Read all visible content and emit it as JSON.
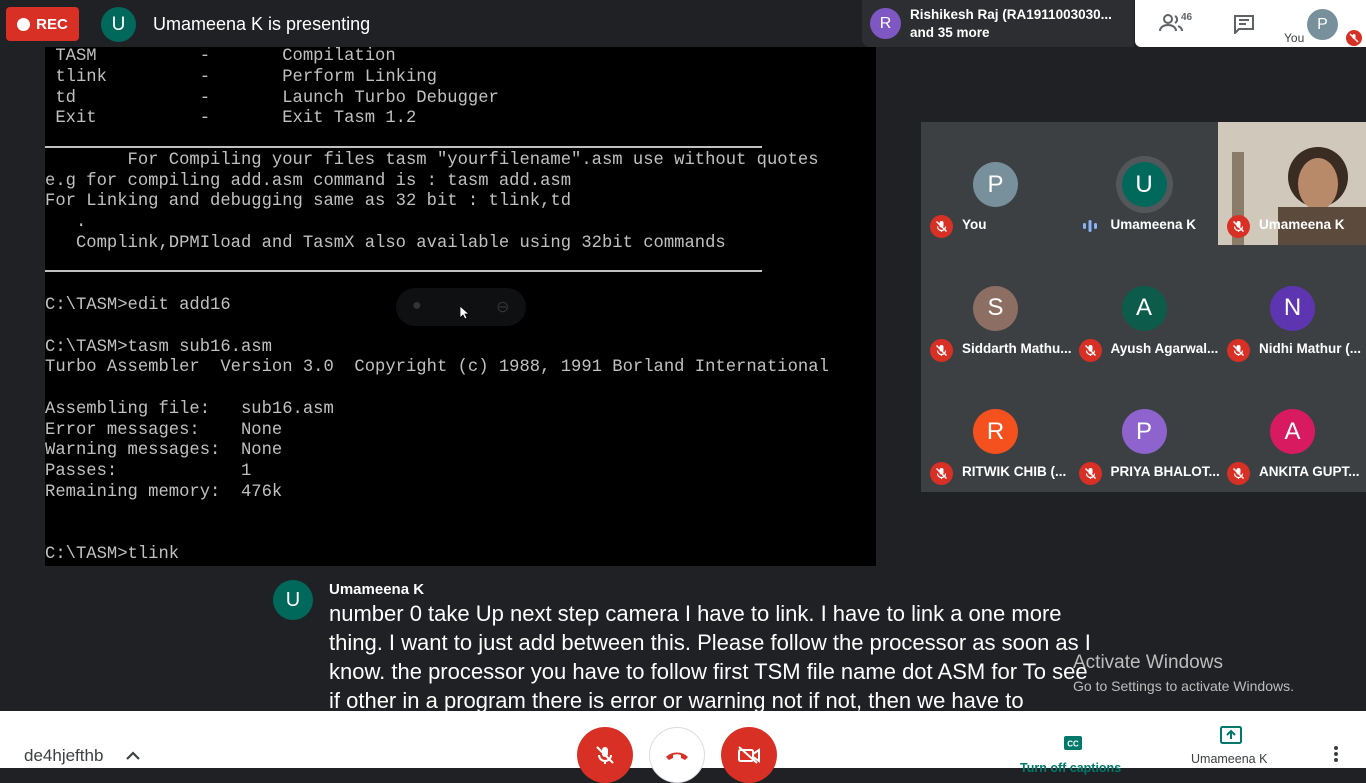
{
  "top_bar": {
    "rec_label": "REC",
    "presenter_initial": "U",
    "presenting_text": "Umameena K is presenting",
    "joiner_initial": "R",
    "joiner_name": "Rishikesh Raj (RA1911003030...",
    "joiner_more": "and 35 more",
    "participant_count": "46",
    "self_label": "You",
    "self_initial": "P"
  },
  "terminal": {
    "lines": [
      " TASM          -       Compilation",
      " tlink         -       Perform Linking",
      " td            -       Launch Turbo Debugger",
      " Exit          -       Exit Tasm 1.2",
      "",
      "        For Compiling your files tasm \"yourfilename\".asm use without quotes",
      "e.g for compiling add.asm command is : tasm add.asm",
      "For Linking and debugging same as 32 bit : tlink,td",
      "   .",
      "   Complink,DPMIload and TasmX also available using 32bit commands",
      "",
      "",
      "C:\\TASM>edit add16",
      "",
      "C:\\TASM>tasm sub16.asm",
      "Turbo Assembler  Version 3.0  Copyright (c) 1988, 1991 Borland International",
      "",
      "Assembling file:   sub16.asm",
      "Error messages:    None",
      "Warning messages:  None",
      "Passes:            1",
      "Remaining memory:  476k",
      "",
      "",
      "C:\\TASM>tlink"
    ]
  },
  "tiles": [
    {
      "initial": "P",
      "name": "You",
      "color": "#78909c",
      "status": "muted"
    },
    {
      "initial": "U",
      "name": "Umameena K",
      "color": "#00695c",
      "status": "speaking"
    },
    {
      "initial": "",
      "name": "Umameena K",
      "color": "",
      "status": "muted",
      "video": true
    },
    {
      "initial": "S",
      "name": "Siddarth Mathu...",
      "color": "#8d6e63",
      "status": "muted"
    },
    {
      "initial": "A",
      "name": "Ayush Agarwal...",
      "color": "#0d5c4b",
      "status": "muted"
    },
    {
      "initial": "N",
      "name": "Nidhi Mathur (...",
      "color": "#5e35b1",
      "status": "muted"
    },
    {
      "initial": "R",
      "name": "RITWIK CHIB (...",
      "color": "#f4511e",
      "status": "muted"
    },
    {
      "initial": "P",
      "name": "PRIYA BHALOT...",
      "color": "#8e63ce",
      "status": "muted"
    },
    {
      "initial": "A",
      "name": "ANKITA GUPT...",
      "color": "#d81b60",
      "status": "muted"
    }
  ],
  "captions": {
    "speaker_initial": "U",
    "speaker_name": "Umameena K",
    "text": "number 0 take Up next step camera I have to link. I have to link a one more thing. I want to just add between this. Please follow the processor as soon as I know. the processor you have to follow first TSM file name dot ASM for To see if other in a program there is error or warning not if not, then we have to proceed for the next step"
  },
  "watermark": {
    "title": "Activate Windows",
    "subtitle": "Go to Settings to activate Windows."
  },
  "bottom_bar": {
    "meeting_code": "de4hjefthb",
    "captions_label": "Turn off captions",
    "presenting_label": "Umameena K"
  },
  "colors": {
    "background": "#202124",
    "rec_red": "#d93025",
    "accent_teal": "#00796b",
    "terminal_text": "#c0c0c0"
  },
  "icons": [
    "record-dot-icon",
    "people-icon",
    "chat-icon",
    "mic-off-icon",
    "audio-wave-icon",
    "chevron-up-icon",
    "end-call-icon",
    "camera-off-icon",
    "captions-icon",
    "present-icon",
    "more-vert-icon",
    "pin-icon",
    "remove-icon"
  ]
}
